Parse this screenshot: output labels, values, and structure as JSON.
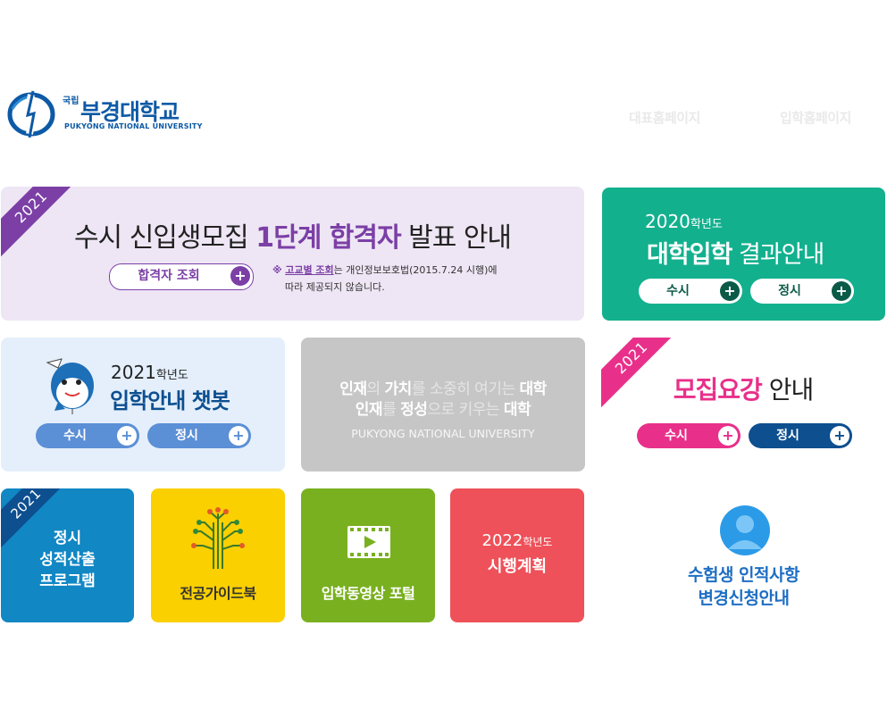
{
  "header": {
    "logo": {
      "small": "국립",
      "main": "부경대학교",
      "sub": "PUKYONG NATIONAL UNIVERSITY"
    },
    "links": [
      "대표홈페이지",
      "입학홈페이지"
    ]
  },
  "banner_pass": {
    "ribbon": "2021",
    "title_pre": "수시 신입생모집 ",
    "title_highlight": "1단계 합격자",
    "title_post": " 발표 안내",
    "button": "합격자 조회",
    "note_mark": "※",
    "note_highlight": "고교별 조회",
    "note_line1": "는 개인정보보호법(2015.7.24 시행)에",
    "note_line2": "따라 제공되지 않습니다."
  },
  "results": {
    "year": "2020",
    "year_suffix": "학년도",
    "title_bold": "대학입학",
    "title_rest": " 결과안내",
    "buttons": [
      "수시",
      "정시"
    ]
  },
  "chatbot": {
    "year": "2021",
    "year_suffix": "학년도",
    "title": "입학안내 챗봇",
    "buttons": [
      "수시",
      "정시"
    ]
  },
  "slogan": {
    "line1": [
      "인재",
      "의",
      "가치",
      "를 소중히 여기는",
      "대학"
    ],
    "line2": [
      "인재",
      "를",
      "정성",
      "으로 키우는",
      "대학"
    ],
    "sub": "PUKYONG NATIONAL UNIVERSITY"
  },
  "guidelines": {
    "ribbon": "2021",
    "title_highlight": "모집요강",
    "title_rest": " 안내",
    "buttons": [
      "수시",
      "정시"
    ]
  },
  "tiles": {
    "score": {
      "ribbon": "2021",
      "lines": [
        "정시",
        "성적산출",
        "프로그램"
      ]
    },
    "major": {
      "label": "전공가이드북"
    },
    "video": {
      "label": "입학동영상 포털"
    },
    "plan": {
      "year": "2022",
      "year_suffix": "학년도",
      "label": "시행계획"
    },
    "change": {
      "lines": [
        "수험생 인적사항",
        "변경신청안내"
      ]
    }
  },
  "plus_symbol": "+",
  "colors": {
    "purple": "#7b3fa6",
    "green": "#13b08e",
    "navy": "#0d4f8f",
    "pink": "#e8308a",
    "blue_tile": "#1187c4",
    "yellow_tile": "#fbd000",
    "olive_tile": "#79b020",
    "red_tile": "#ee5159"
  }
}
